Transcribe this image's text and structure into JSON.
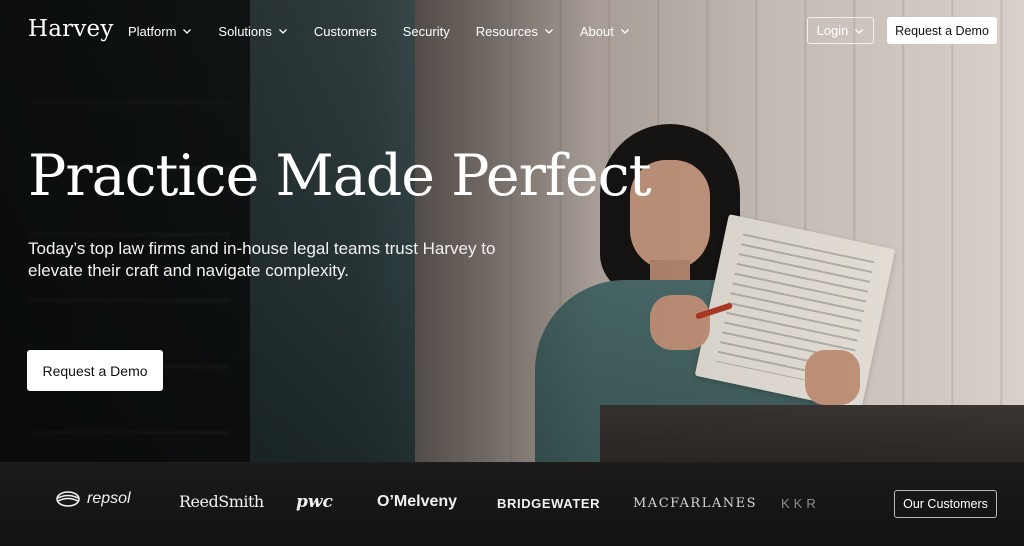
{
  "brand": {
    "name": "Harvey"
  },
  "nav": {
    "items": [
      {
        "label": "Platform",
        "has_dropdown": true
      },
      {
        "label": "Solutions",
        "has_dropdown": true
      },
      {
        "label": "Customers",
        "has_dropdown": false
      },
      {
        "label": "Security",
        "has_dropdown": false
      },
      {
        "label": "Resources",
        "has_dropdown": true
      },
      {
        "label": "About",
        "has_dropdown": true
      }
    ],
    "login_label": "Login",
    "demo_label": "Request a Demo"
  },
  "hero": {
    "title": "Practice Made Perfect",
    "subtitle": "Today’s top law firms and in-house legal teams trust Harvey to elevate their craft and navigate complexity.",
    "cta_label": "Request a Demo"
  },
  "customers": {
    "logos": [
      "repsol",
      "ReedSmith",
      "pwc",
      "O’Melveny",
      "BRIDGEWATER",
      "MACFARLANES",
      "KKR"
    ],
    "button_label": "Our Customers"
  },
  "colors": {
    "primary_button_bg": "#ffffff",
    "primary_button_text": "#111111",
    "logo_bar_bg": "#161515"
  }
}
